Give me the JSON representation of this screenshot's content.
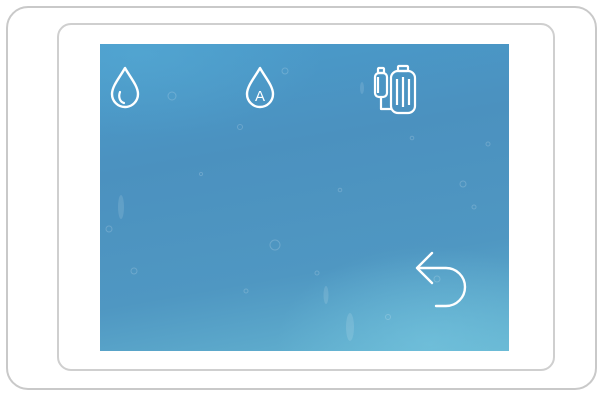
{
  "device": {
    "screen": {
      "top_icons": [
        {
          "name": "drop-icon",
          "meaning": "water"
        },
        {
          "name": "drop-auto-icon",
          "meaning": "auto water",
          "letter": "A"
        },
        {
          "name": "filter-cartridges-icon",
          "meaning": "filters"
        }
      ],
      "back_icon": "back-arrow-icon"
    }
  },
  "colors": {
    "screen_blue": "#4b91bf",
    "screen_light": "#66b6d2",
    "icon_stroke": "#ffffff",
    "bezel_border": "#cfcfcf",
    "frame_border": "#c9c9c9"
  }
}
